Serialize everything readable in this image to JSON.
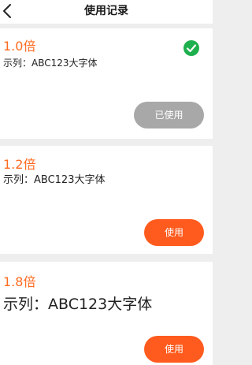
{
  "header": {
    "title": "使用记录",
    "back_icon": "chevron-left-icon"
  },
  "colors": {
    "accent": "#ff5b1e",
    "multiplier": "#ff6a1f",
    "used_button": "#a8a8a8",
    "check": "#1fb04e",
    "background": "#eeeeee"
  },
  "records": [
    {
      "multiplier": "1.0倍",
      "example": "示列：ABC123大字体",
      "status_icon": "check-circle-icon",
      "button_label": "已使用"
    },
    {
      "multiplier": "1.2倍",
      "example": "示列：ABC123大字体",
      "button_label": "使用"
    },
    {
      "multiplier": "1.8倍",
      "example": "示列：ABC123大字体",
      "button_label": "使用"
    }
  ]
}
